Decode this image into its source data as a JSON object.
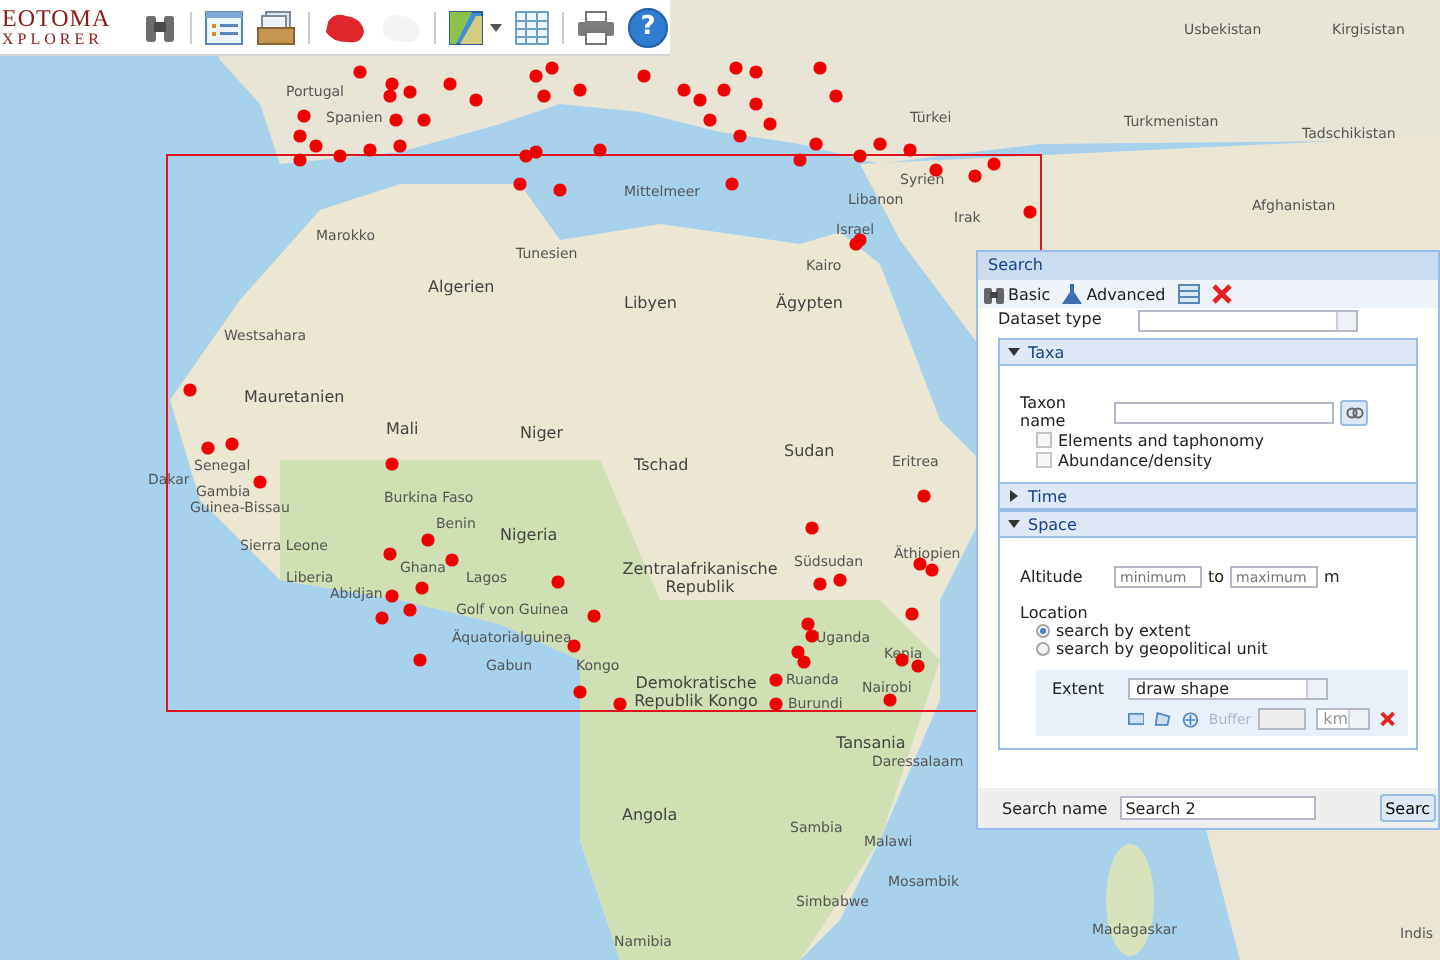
{
  "app": {
    "logo_lines": [
      "EOTOMA",
      "XPLORER"
    ]
  },
  "toolbar": {
    "help_label": "?"
  },
  "map": {
    "labels": [
      {
        "text": "Portugal"
      },
      {
        "text": "Spanien"
      },
      {
        "text": "Mittelmeer"
      },
      {
        "text": "Tunesien"
      },
      {
        "text": "Marokko"
      },
      {
        "text": "Algerien"
      },
      {
        "text": "Libyen"
      },
      {
        "text": "Kairo"
      },
      {
        "text": "Ägypten"
      },
      {
        "text": "Libanon"
      },
      {
        "text": "Israel"
      },
      {
        "text": "Syrien"
      },
      {
        "text": "Irak"
      },
      {
        "text": "Türkei"
      },
      {
        "text": "Westsahara"
      },
      {
        "text": "Mauretanien"
      },
      {
        "text": "Mali"
      },
      {
        "text": "Niger"
      },
      {
        "text": "Tschad"
      },
      {
        "text": "Sudan"
      },
      {
        "text": "Eritrea"
      },
      {
        "text": "Dakar"
      },
      {
        "text": "Senegal"
      },
      {
        "text": "Gambia"
      },
      {
        "text": "Guinea-Bissau"
      },
      {
        "text": "Burkina Faso"
      },
      {
        "text": "Benin"
      },
      {
        "text": "Nigeria"
      },
      {
        "text": "Sierra Leone"
      },
      {
        "text": "Liberia"
      },
      {
        "text": "Ghana"
      },
      {
        "text": "Abidjan"
      },
      {
        "text": "Lagos"
      },
      {
        "text": "Golf von Guinea"
      },
      {
        "text": "Zentralafrikanische Republik"
      },
      {
        "text": "Südsudan"
      },
      {
        "text": "Äthiopien"
      },
      {
        "text": "Äquatorialguinea"
      },
      {
        "text": "Gabun"
      },
      {
        "text": "Kongo"
      },
      {
        "text": "Demokratische Republik Kongo"
      },
      {
        "text": "Uganda"
      },
      {
        "text": "Kenia"
      },
      {
        "text": "Ruanda"
      },
      {
        "text": "Nairobi"
      },
      {
        "text": "Burundi"
      },
      {
        "text": "Tansania"
      },
      {
        "text": "Daressalaam"
      },
      {
        "text": "Angola"
      },
      {
        "text": "Sambia"
      },
      {
        "text": "Malawi"
      },
      {
        "text": "Mosambik"
      },
      {
        "text": "Simbabwe"
      },
      {
        "text": "Namibia"
      },
      {
        "text": "Madagaskar"
      },
      {
        "text": "Usbekistan"
      },
      {
        "text": "Kirgisistan"
      },
      {
        "text": "Turkmenistan"
      },
      {
        "text": "Tadschikistan"
      },
      {
        "text": "Afghanistan"
      },
      {
        "text": "Indis"
      }
    ]
  },
  "search_panel": {
    "title": "Search",
    "tools": [
      {
        "label": "Basic"
      },
      {
        "label": "Advanced"
      }
    ],
    "dataset_type_label": "Dataset type",
    "sections": [
      {
        "kind": "taxa",
        "title": "Taxa",
        "expanded": true
      },
      {
        "kind": "time",
        "title": "Time",
        "expanded": false
      },
      {
        "kind": "space",
        "title": "Space",
        "expanded": true
      }
    ],
    "taxa": {
      "taxon_label": "Taxon name",
      "options": [
        {
          "label": "Elements and taphonomy",
          "checked": false
        },
        {
          "label": "Abundance/density",
          "checked": false
        }
      ]
    },
    "space": {
      "altitude_label": "Altitude",
      "min_placeholder": "minimum",
      "to_label": "to",
      "max_placeholder": "maximum",
      "unit": "m",
      "location_label": "Location",
      "location_options": [
        {
          "label": "search by extent",
          "selected": true
        },
        {
          "label": "search by geopolitical unit",
          "selected": false
        }
      ],
      "extent_label": "Extent",
      "extent_value": "draw shape",
      "buffer_placeholder": "Buffer",
      "buffer_unit": "km"
    },
    "footer": {
      "name_label": "Search name",
      "name_value": "Search 2",
      "button": "Searc"
    }
  }
}
